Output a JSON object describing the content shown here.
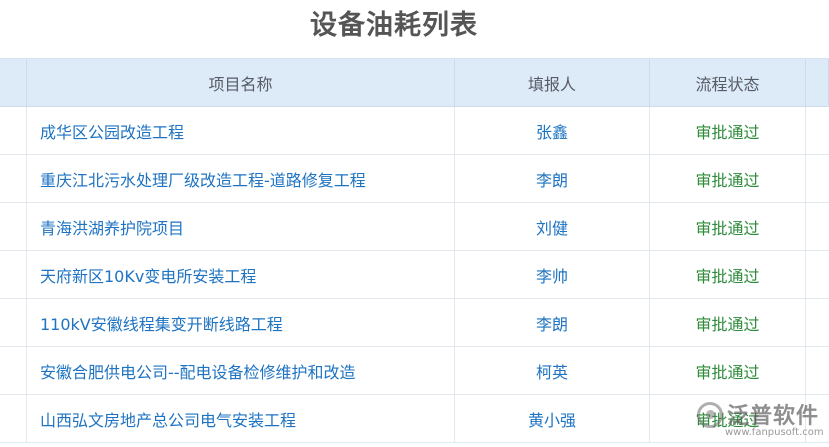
{
  "page": {
    "title": "设备油耗列表"
  },
  "table": {
    "headers": {
      "project_name": "项目名称",
      "filler": "填报人",
      "flow_status": "流程状态"
    },
    "rows": [
      {
        "project_name": "成华区公园改造工程",
        "filler": "张鑫",
        "flow_status": "审批通过"
      },
      {
        "project_name": "重庆江北污水处理厂级改造工程-道路修复工程",
        "filler": "李朗",
        "flow_status": "审批通过"
      },
      {
        "project_name": "青海洪湖养护院项目",
        "filler": "刘健",
        "flow_status": "审批通过"
      },
      {
        "project_name": "天府新区10Kv变电所安装工程",
        "filler": "李帅",
        "flow_status": "审批通过"
      },
      {
        "project_name": "110kV安徽线程集变开断线路工程",
        "filler": "李朗",
        "flow_status": "审批通过"
      },
      {
        "project_name": "安徽合肥供电公司--配电设备检修维护和改造",
        "filler": "柯英",
        "flow_status": "审批通过"
      },
      {
        "project_name": "山西弘文房地产总公司电气安装工程",
        "filler": "黄小强",
        "flow_status": "审批通过"
      }
    ]
  },
  "watermark": {
    "brand": "泛普软件",
    "url": "www.fanpusoft.com"
  },
  "colors": {
    "header_bg": "#ddeaf7",
    "link": "#1e73c2",
    "status_ok": "#2e8b3a",
    "title": "#555555"
  }
}
